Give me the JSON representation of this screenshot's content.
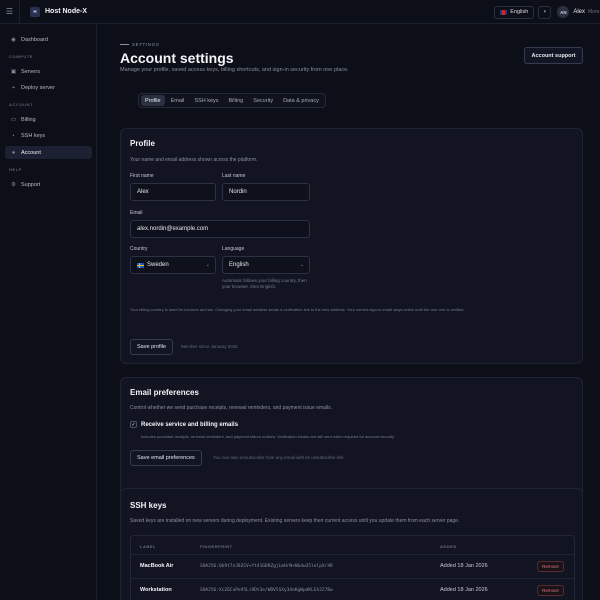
{
  "app": {
    "brand_initials": "H",
    "brand_name": "Host Node-X"
  },
  "topbar": {
    "language": "English",
    "user_initials": "AN",
    "user_name": "Alex",
    "user_sub": "More"
  },
  "sidebar": {
    "dashboard": "Dashboard",
    "section_compute": "COMPUTE",
    "servers": "Servers",
    "deploy_server": "Deploy server",
    "section_account": "ACCOUNT",
    "billing": "Billing",
    "ssh_keys": "SSH keys",
    "account": "Account",
    "section_help": "HELP",
    "support": "Support"
  },
  "header": {
    "eyebrow": "SETTINGS",
    "title": "Account settings",
    "subtitle": "Manage your profile, saved access keys, billing shortcuts, and sign-in security from one place.",
    "account_support": "Account support"
  },
  "tabs": [
    "Profile",
    "Email",
    "SSH keys",
    "Billing",
    "Security",
    "Data & privacy"
  ],
  "profile": {
    "title": "Profile",
    "desc": "Your name and email address shown across the platform.",
    "first_name_label": "First name",
    "first_name_value": "Alex",
    "last_name_label": "Last name",
    "last_name_value": "Nordin",
    "email_label": "Email",
    "email_value": "alex.nordin@example.com",
    "country_label": "Country",
    "country_value": "Sweden",
    "language_label": "Language",
    "language_value": "English",
    "language_note": "Automatic follows your billing country, then your browser, then English.",
    "footnote": "Your billing country is used for invoices and tax. Changing your email address sends a verification link to the new address. Your current sign-in email stays active until the new one is verified.",
    "save_label": "Save profile",
    "member_since": "Member since January 2026"
  },
  "email_prefs": {
    "title": "Email preferences",
    "desc": "Control whether we send purchase receipts, renewal reminders, and payment issue emails.",
    "checkbox_label": "Receive service and billing emails",
    "checkbox_note": "Includes purchase receipts, renewal reminders, and payment failure notices. Verification emails are still sent when required for account security.",
    "save_label": "Save email preferences",
    "unsubscribe_note": "You can also unsubscribe from any email with its unsubscribe link."
  },
  "ssh": {
    "title": "SSH keys",
    "desc": "Saved keys are installed on new servers during deployment. Existing servers keep their current access until you update them from each server page.",
    "col_label": "LABEL",
    "col_fingerprint": "FINGERPRINT",
    "col_added": "ADDED",
    "rows": [
      {
        "label": "MacBook Air",
        "fingerprint": "SHA256:Qk9t7nJ8ZCV+Yt41GDRZgjLmHrN+NGdw35lelpXrXR",
        "added": "Added 18 Jan 2026",
        "action": "Remove"
      },
      {
        "label": "Workstation",
        "fingerprint": "SHA256:XiZ6CuPeV5Li9Dt3e/WDV5SXy34eKgWpdKLEh227Bw",
        "added": "Added 18 Jan 2026",
        "action": "Remove"
      }
    ]
  }
}
